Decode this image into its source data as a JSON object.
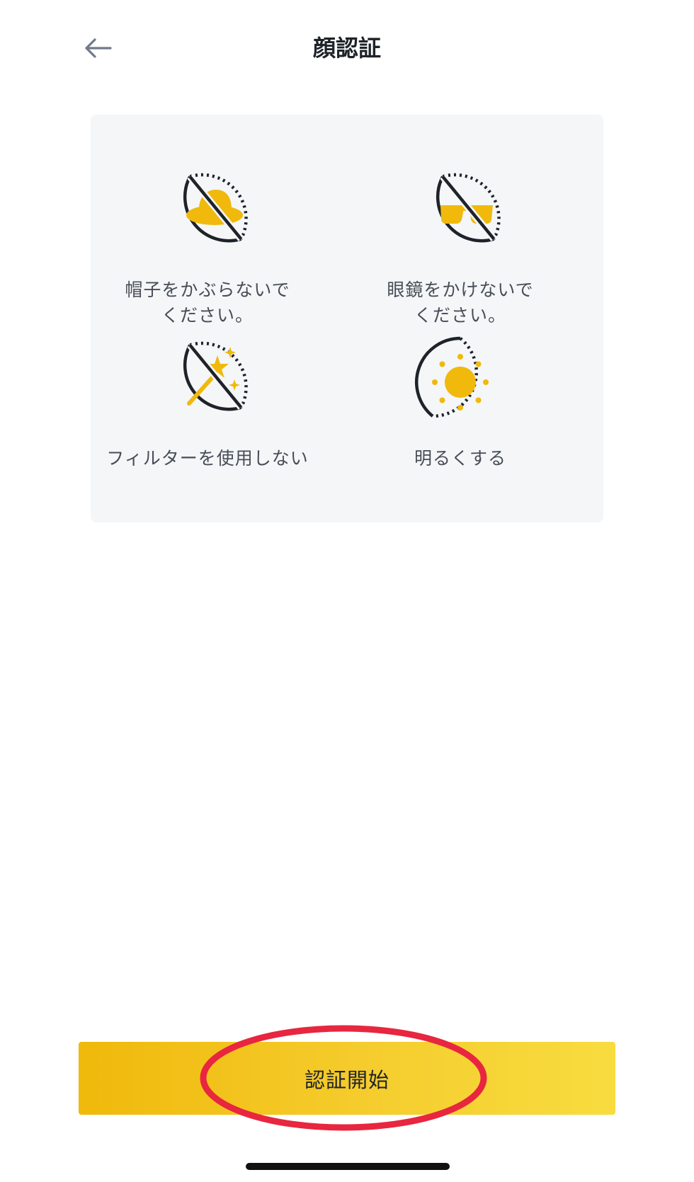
{
  "header": {
    "title": "顔認証",
    "back_icon": "arrow-left-icon"
  },
  "tips": [
    {
      "icon": "no-hat-icon",
      "label": "帽子をかぶらないで\nください。"
    },
    {
      "icon": "no-glasses-icon",
      "label": "眼鏡をかけないで\nください。"
    },
    {
      "icon": "no-filter-icon",
      "label": "フィルターを使用しない"
    },
    {
      "icon": "brightness-icon",
      "label": "明るくする"
    }
  ],
  "start_button": {
    "label": "認証開始"
  },
  "colors": {
    "accent": "#f0b90b",
    "icon_stroke": "#1e2329",
    "card_background": "#f4f6f8",
    "highlight": "#e8263f"
  }
}
